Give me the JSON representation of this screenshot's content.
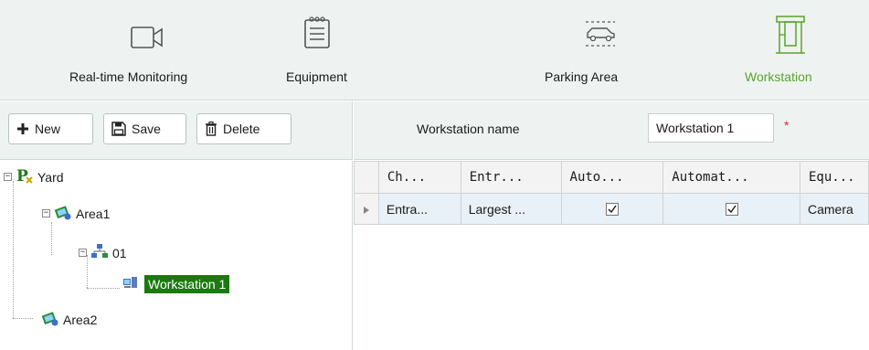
{
  "toolbar": {
    "realtime_label": "Real-time Monitoring",
    "equipment_label": "Equipment",
    "parking_label": "Parking Area",
    "workstation_label": "Workstation"
  },
  "actions": {
    "new_label": "New",
    "save_label": "Save",
    "delete_label": "Delete"
  },
  "form": {
    "workstation_name_label": "Workstation name",
    "workstation_name_value": "Workstation 1",
    "required_mark": "*"
  },
  "tree": {
    "root": "Yard",
    "area1": "Area1",
    "node01": "01",
    "workstation": "Workstation 1",
    "area2": "Area2"
  },
  "grid": {
    "headers": [
      "Ch...",
      "Entr...",
      "Auto...",
      "Automat...",
      "Equ..."
    ],
    "rows": [
      {
        "c0": "Entra...",
        "c1": "Largest ...",
        "c2_checked": true,
        "c3_checked": true,
        "c4": "Camera"
      }
    ]
  },
  "colors": {
    "accent_green": "#5aa32b",
    "selection_green": "#1a7a10",
    "required_red": "#e0242b"
  },
  "icons": {
    "realtime": "video-camera-icon",
    "equipment": "device-list-icon",
    "parking": "car-icon",
    "workstation": "workstation-booth-icon"
  }
}
